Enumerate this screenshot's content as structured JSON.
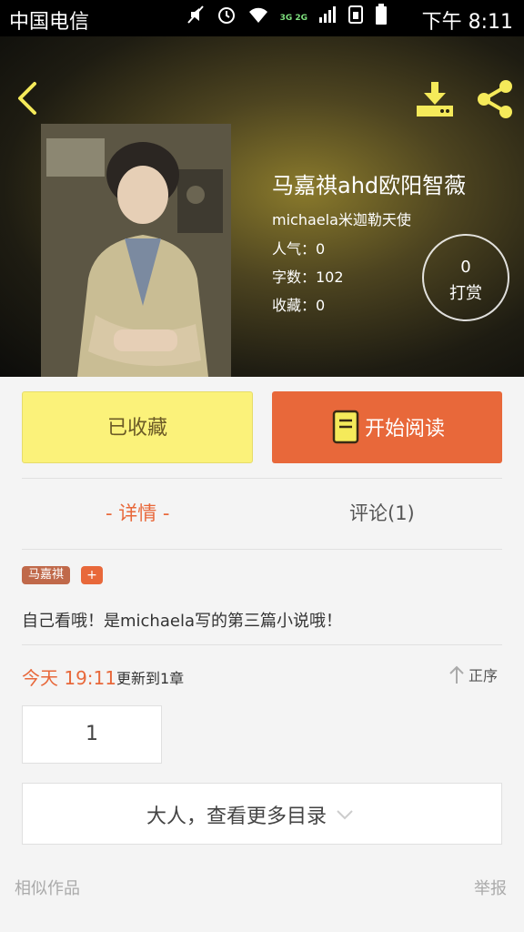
{
  "status_bar": {
    "carrier": "中国电信",
    "network_label": "3G 2G",
    "time": "下午 8:11",
    "icons": [
      "mute-icon",
      "alarm-icon",
      "wifi-icon",
      "signal-icon",
      "sim-icon",
      "battery-icon"
    ]
  },
  "header": {
    "icons": [
      "back-icon",
      "download-icon",
      "share-icon"
    ],
    "accent_color": "#f5ea5a"
  },
  "book": {
    "title": "马嘉祺ahd欧阳智薇",
    "author": "michaela米迦勒天使",
    "popularity": "人气：0",
    "word_count": "字数：102",
    "favorites": "收藏：0",
    "tip_count": "0",
    "tip_label": "打赏"
  },
  "actions": {
    "collected_label": "已收藏",
    "read_label": "开始阅读",
    "read_color": "#e8683a",
    "collected_color": "#fbf27a"
  },
  "tabs": {
    "details": "- 详情 -",
    "comments": "评论(1)"
  },
  "tags": {
    "items": [
      "马嘉祺"
    ],
    "add": "+"
  },
  "intro": "自己看哦！是michaela写的第三篇小说哦！",
  "update": {
    "time": "今天 19:11",
    "text": "更新到1章",
    "sort_label": "正序"
  },
  "catalog": {
    "chapter": "1",
    "more": "大人，查看更多目录"
  },
  "footer": {
    "similar": "相似作品",
    "report": "举报"
  }
}
